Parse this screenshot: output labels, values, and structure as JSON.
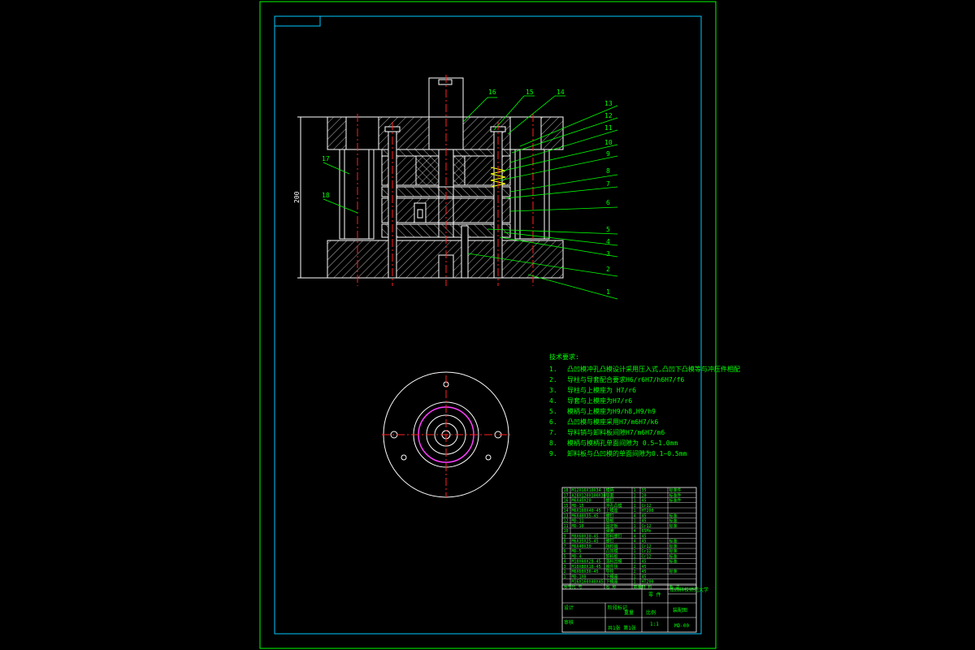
{
  "colors": {
    "background": "#000000",
    "outer_frame": "#00ff00",
    "inner_frame": "#00c8ff",
    "geometry": "#ffffff",
    "leader": "#00ff00",
    "centerline": "#ff2020",
    "spring": "#ffff00",
    "ring": "#ff40ff"
  },
  "part_labels": [
    "1",
    "2",
    "3",
    "4",
    "5",
    "6",
    "7",
    "8",
    "9",
    "10",
    "11",
    "12",
    "13",
    "14",
    "15",
    "16",
    "17",
    "18"
  ],
  "dimension_label": "200",
  "tech_requirements": {
    "heading": "技术要求:",
    "items": [
      {
        "num": "1.",
        "text": "凸凹模冲孔凸模设计采用压入式,凸凹下凸模等与冲压件相配"
      },
      {
        "num": "2.",
        "text": "导柱与导套配合要求H6/r6H7/h6H7/f6"
      },
      {
        "num": "3.",
        "text": "导柱与上模座为 H7/r6"
      },
      {
        "num": "4.",
        "text": "导套与上模座为H7/r6"
      },
      {
        "num": "5.",
        "text": "模柄与上模座为H9/h8,H9/h9"
      },
      {
        "num": "6.",
        "text": "凸凹模与模座采用H7/m6H7/k6"
      },
      {
        "num": "7.",
        "text": "导料销与卸料板间隙H7/m6H7/m6"
      },
      {
        "num": "8.",
        "text": "模柄与模柄孔单面间隙为 0.5~1.0mm"
      },
      {
        "num": "9.",
        "text": "卸料板与凸凹模的单面间隙为0.1~0.5mm"
      }
    ]
  },
  "bom_rows": [
    {
      "no": "18",
      "name": "M12X16X10X34",
      "desc": "模柄",
      "qty": "1",
      "mat": "35",
      "note": "标准件"
    },
    {
      "no": "17",
      "name": "A28X120X100X38",
      "desc": "导套",
      "qty": "1",
      "mat": "20",
      "note": "标准件"
    },
    {
      "no": "16",
      "name": "M6X45X20",
      "desc": "螺钉",
      "qty": "1",
      "mat": "45",
      "note": "标准件"
    },
    {
      "no": "15",
      "name": "MD-15",
      "desc": "冲孔凸模",
      "qty": "1",
      "mat": "Cr12",
      "note": ""
    },
    {
      "no": "14",
      "name": "M6X160X40-45",
      "desc": "上模座",
      "qty": "1",
      "mat": "HT200",
      "note": ""
    },
    {
      "no": "13",
      "name": "M6X40X35-45",
      "desc": "螺钉",
      "qty": "4",
      "mat": "45",
      "note": "标准"
    },
    {
      "no": "12",
      "name": "MD-11",
      "desc": "垫板",
      "qty": "1",
      "mat": "45",
      "note": "标准"
    },
    {
      "no": "11",
      "name": "MD-10",
      "desc": "固定板",
      "qty": "1",
      "mat": "Cr12",
      "note": "标准"
    },
    {
      "no": "10",
      "name": "",
      "desc": "弹簧",
      "qty": "4",
      "mat": "65Mn",
      "note": ""
    },
    {
      "no": "9",
      "name": "M8X60X30-45",
      "desc": "卸料螺钉",
      "qty": "4",
      "mat": "45",
      "note": ""
    },
    {
      "no": "8",
      "name": "M6X35X25-45",
      "desc": "螺钉",
      "qty": "4",
      "mat": "45",
      "note": "标准"
    },
    {
      "no": "7",
      "name": "M6X40X30",
      "desc": "挡料销",
      "qty": "1",
      "mat": "Cr12",
      "note": "标准"
    },
    {
      "no": "6",
      "name": "MD-5",
      "desc": "凸凹模",
      "qty": "1",
      "mat": "Cr12",
      "note": "标准"
    },
    {
      "no": "5",
      "name": "MD-4",
      "desc": "卸料板",
      "qty": "1",
      "mat": "Cr12",
      "note": "标准"
    },
    {
      "no": "4",
      "name": "M10X60X28-45",
      "desc": "落料凹模",
      "qty": "1",
      "mat": "45",
      "note": "标准"
    },
    {
      "no": "3",
      "name": "M10X80X16-45",
      "desc": "推件块",
      "qty": "2",
      "mat": "45",
      "note": ""
    },
    {
      "no": "2",
      "name": "M6X60X36-45",
      "desc": "导柱",
      "qty": "2",
      "mat": "45",
      "note": "标准"
    },
    {
      "no": "1",
      "name": "MD-1X0",
      "desc": "下模座",
      "qty": "1",
      "mat": "45",
      "note": ""
    },
    {
      "no": "",
      "name": "M16X160X40X45",
      "desc": "下模座",
      "qty": "1",
      "mat": "HT200",
      "note": ""
    }
  ],
  "bom_header": {
    "no": "序号",
    "name": "代 号",
    "desc": "名 称",
    "qty": "数量",
    "mat": "材 料",
    "note": "备 注"
  },
  "title_block": {
    "school": "江西科技师范大学",
    "drawing_title": "装配图",
    "part_label": "零 件",
    "drawing_no": "MD-00",
    "scale": "1:1",
    "sheet": "共1张 第1张",
    "design": "设计",
    "check": "审核",
    "stage": "阶段标记",
    "weight": "重量",
    "ratio": "比例"
  }
}
